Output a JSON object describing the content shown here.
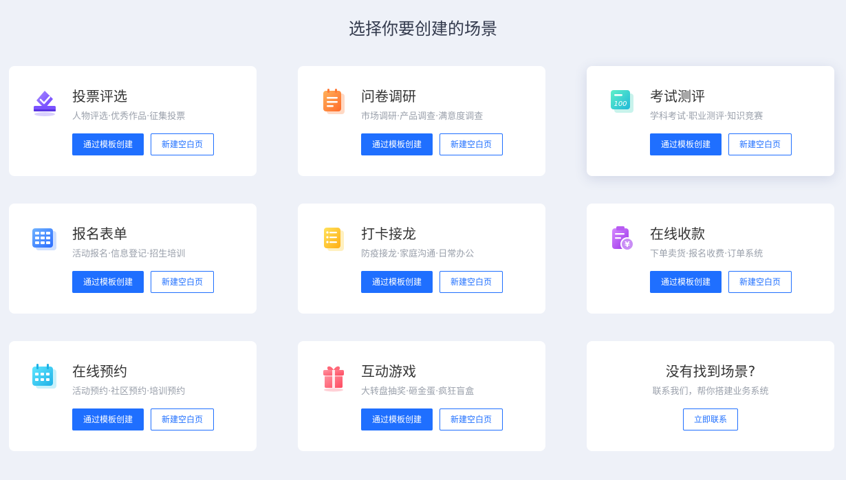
{
  "header": {
    "title": "选择你要创建的场景"
  },
  "cards": [
    {
      "title": "投票评选",
      "desc": "人物评选·优秀作品·征集投票",
      "primary": "通过模板创建",
      "secondary": "新建空白页",
      "icon": "vote-icon",
      "accent": "#7b5cff"
    },
    {
      "title": "问卷调研",
      "desc": "市场调研·产品调查·满意度调查",
      "primary": "通过模板创建",
      "secondary": "新建空白页",
      "icon": "questionnaire-icon",
      "accent": "#ff8a3d"
    },
    {
      "title": "考试测评",
      "desc": "学科考试·职业测评·知识竞赛",
      "primary": "通过模板创建",
      "secondary": "新建空白页",
      "icon": "exam-icon",
      "accent": "#2fd6b8",
      "icon_text": "100"
    },
    {
      "title": "报名表单",
      "desc": "活动报名·信息登记·招生培训",
      "primary": "通过模板创建",
      "secondary": "新建空白页",
      "icon": "form-grid-icon",
      "accent": "#3c8cff"
    },
    {
      "title": "打卡接龙",
      "desc": "防疫接龙·家庭沟通·日常办公",
      "primary": "通过模板创建",
      "secondary": "新建空白页",
      "icon": "checklist-icon",
      "accent": "#ffc21f"
    },
    {
      "title": "在线收款",
      "desc": "下单卖货·报名收费·订单系统",
      "primary": "通过模板创建",
      "secondary": "新建空白页",
      "icon": "payment-icon",
      "accent": "#b14cf0",
      "icon_text": "¥"
    },
    {
      "title": "在线预约",
      "desc": "活动预约·社区预约·培训预约",
      "primary": "通过模板创建",
      "secondary": "新建空白页",
      "icon": "calendar-icon",
      "accent": "#2fc8ee"
    },
    {
      "title": "互动游戏",
      "desc": "大转盘抽奖·砸金蛋·疯狂盲盒",
      "primary": "通过模板创建",
      "secondary": "新建空白页",
      "icon": "gift-icon",
      "accent": "#ff5a6e"
    }
  ],
  "contact": {
    "title": "没有找到场景?",
    "desc": "联系我们，帮你搭建业务系统",
    "button": "立即联系"
  },
  "colors": {
    "primary": "#1f6fff",
    "background": "#eef1f8",
    "card": "#ffffff"
  }
}
